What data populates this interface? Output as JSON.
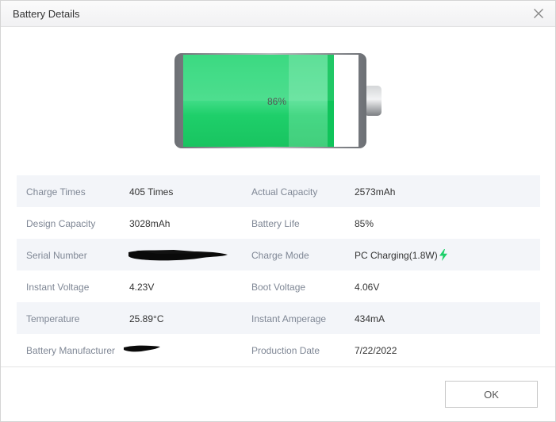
{
  "window": {
    "title": "Battery Details",
    "close_icon": "close-icon"
  },
  "battery": {
    "percent_label": "86%",
    "level": 0.86,
    "fill_color": "#1ecf6a",
    "fill_light_color": "#5be19a"
  },
  "details": {
    "rows": [
      {
        "label_left": "Charge Times",
        "value_left": "405 Times",
        "label_right": "Actual Capacity",
        "value_right": "2573mAh"
      },
      {
        "label_left": "Design Capacity",
        "value_left": "3028mAh",
        "label_right": "Battery Life",
        "value_right": "85%"
      },
      {
        "label_left": "Serial Number",
        "value_left": "",
        "label_right": "Charge Mode",
        "value_right": "PC Charging(1.8W)"
      },
      {
        "label_left": "Instant Voltage",
        "value_left": "4.23V",
        "label_right": "Boot Voltage",
        "value_right": "4.06V"
      },
      {
        "label_left": "Temperature",
        "value_left": "25.89°C",
        "label_right": "Instant Amperage",
        "value_right": "434mA"
      },
      {
        "label_left": "Battery Manufacturer",
        "value_left": "",
        "label_right": "Production Date",
        "value_right": "7/22/2022"
      }
    ],
    "charge_icon": "lightning-bolt-icon",
    "charge_icon_color": "#1ecf6a"
  },
  "footer": {
    "ok_label": "OK"
  }
}
